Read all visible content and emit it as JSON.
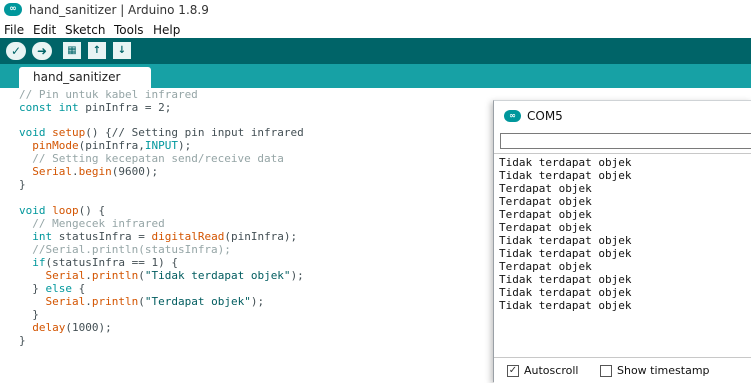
{
  "window": {
    "title": "hand_sanitizer | Arduino 1.8.9",
    "logo_glyph": "∞"
  },
  "menu": [
    {
      "label": "File"
    },
    {
      "label": "Edit"
    },
    {
      "label": "Sketch"
    },
    {
      "label": "Tools"
    },
    {
      "label": "Help"
    }
  ],
  "toolbar": {
    "verify_glyph": "✓",
    "upload_glyph": "➜",
    "new_glyph": "▦",
    "open_glyph": "↑",
    "save_glyph": "↓"
  },
  "tab": {
    "label": "hand_sanitizer"
  },
  "code": {
    "l1": "// Pin untuk kabel infrared",
    "l2": [
      "const int",
      " pinInfra = 2;"
    ],
    "l4": [
      "void",
      " setup",
      "() {// Setting pin input infrared"
    ],
    "l5": [
      "pinMode",
      "(pinInfra,",
      "INPUT",
      ");"
    ],
    "l6": "// Setting kecepatan send/receive data",
    "l7": [
      "Serial",
      ".",
      "begin",
      "(9600);"
    ],
    "l8": "}",
    "l10": [
      "void",
      " loop",
      "() {"
    ],
    "l11": "// Mengecek infrared",
    "l12": [
      "int",
      " statusInfra = ",
      "digitalRead",
      "(pinInfra);"
    ],
    "l13": "//Serial.println(statusInfra);",
    "l14": [
      "if",
      "(statusInfra == 1) {"
    ],
    "l15": [
      "Serial",
      ".",
      "println",
      "(",
      "\"Tidak terdapat objek\"",
      ");"
    ],
    "l16": [
      "} ",
      "else",
      " {"
    ],
    "l17": [
      "Serial",
      ".",
      "println",
      "(",
      "\"Terdapat objek\"",
      ");"
    ],
    "l18": "}",
    "l19": [
      "delay",
      "(1000);"
    ],
    "l20": "}"
  },
  "serial_monitor": {
    "title": "COM5",
    "logo_glyph": "∞",
    "input_value": "",
    "output": [
      "Tidak terdapat objek",
      "Tidak terdapat objek",
      "Terdapat objek",
      "Terdapat objek",
      "Terdapat objek",
      "Terdapat objek",
      "Tidak terdapat objek",
      "Tidak terdapat objek",
      "Terdapat objek",
      "Tidak terdapat objek",
      "Tidak terdapat objek",
      "Tidak terdapat objek"
    ],
    "autoscroll": {
      "label": "Autoscroll",
      "checked": true,
      "mark": "✓"
    },
    "show_timestamp": {
      "label": "Show timestamp",
      "checked": false
    }
  },
  "colors": {
    "toolbar": "#006468",
    "tabstrip": "#17a1a5",
    "keyword": "#00979c",
    "function": "#d35400",
    "comment": "#95a5a6"
  }
}
